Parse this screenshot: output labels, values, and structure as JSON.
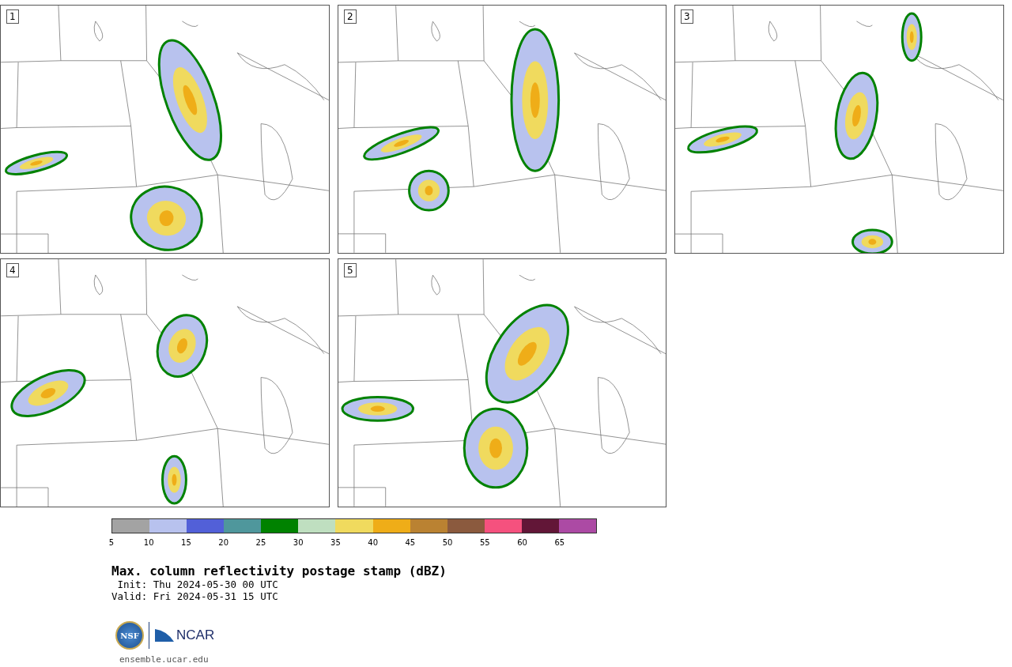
{
  "panels": [
    {
      "number": "1"
    },
    {
      "number": "2"
    },
    {
      "number": "3"
    },
    {
      "number": "4"
    },
    {
      "number": "5"
    }
  ],
  "colorbar": {
    "segments": [
      {
        "color": "#a3a3a3",
        "tick": "5"
      },
      {
        "color": "#b8c2ee",
        "tick": "10"
      },
      {
        "color": "#5260d8",
        "tick": "15"
      },
      {
        "color": "#4f979c",
        "tick": "20"
      },
      {
        "color": "#008200",
        "tick": "25"
      },
      {
        "color": "#bfdfc0",
        "tick": "30"
      },
      {
        "color": "#f0da5e",
        "tick": "35"
      },
      {
        "color": "#efad18",
        "tick": "40"
      },
      {
        "color": "#ba8232",
        "tick": "45"
      },
      {
        "color": "#8b5a3e",
        "tick": "50"
      },
      {
        "color": "#f5517e",
        "tick": "55"
      },
      {
        "color": "#621637",
        "tick": "60"
      },
      {
        "color": "#ac4aa4",
        "tick": "65"
      }
    ]
  },
  "title": "Max. column reflectivity postage stamp (dBZ)",
  "init": " Init: Thu 2024-05-30 00 UTC",
  "valid": "Valid: Fri 2024-05-31 15 UTC",
  "logo": {
    "seal_text": "NSF",
    "wordmark": "NCAR"
  },
  "footer": "ensemble.ucar.edu"
}
